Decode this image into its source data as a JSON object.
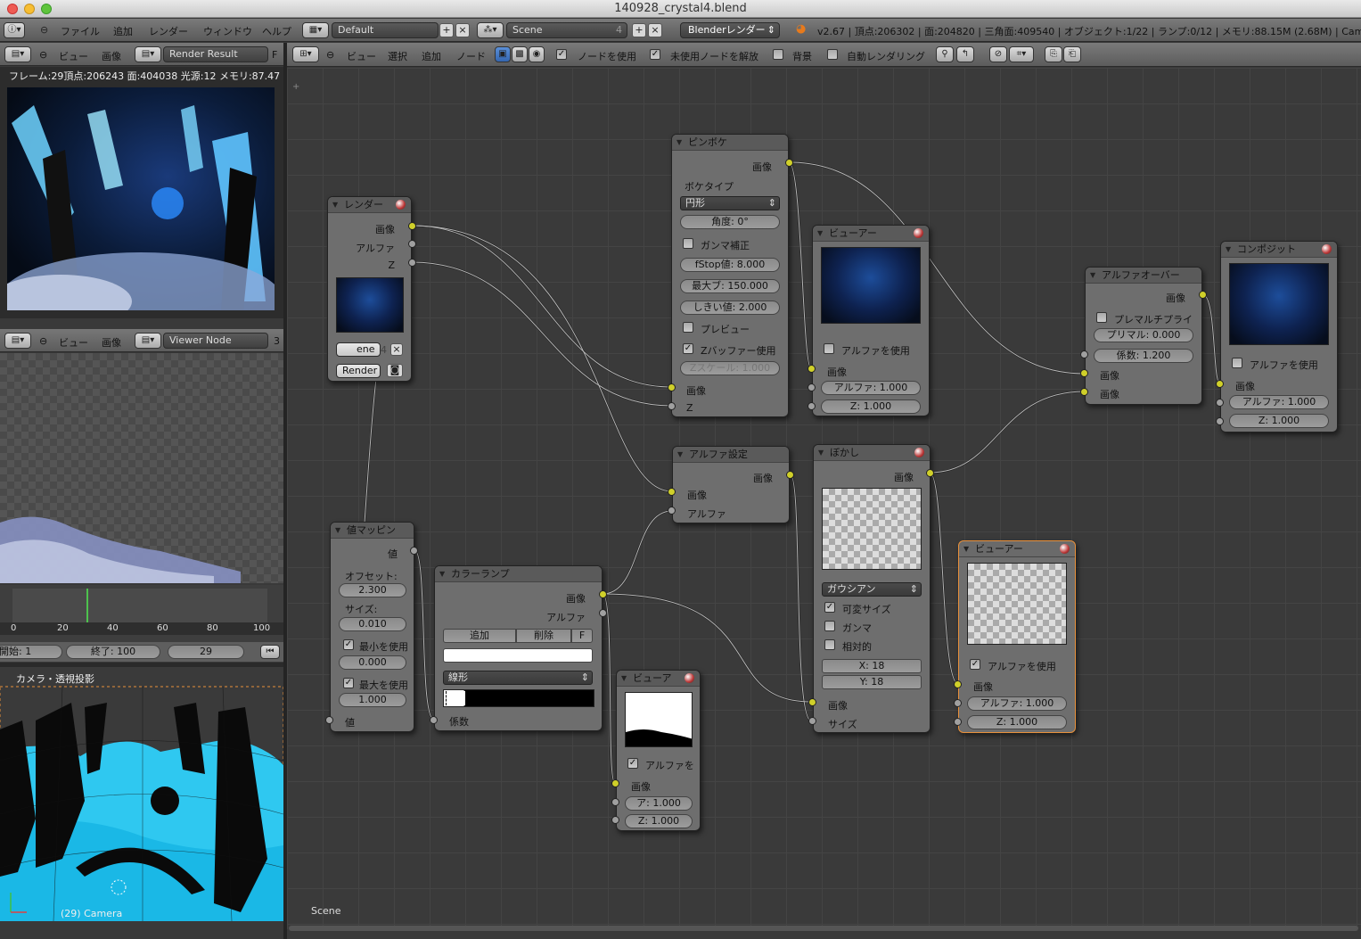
{
  "window": {
    "title": "140928_crystal4.blend"
  },
  "main_header": {
    "menus": [
      "ファイル",
      "追加",
      "レンダー",
      "ウィンドウ",
      "ヘルプ"
    ],
    "layout": "Default",
    "scene": "Scene",
    "scene_users": "4",
    "engine": "Blenderレンダー",
    "stats": "v2.67 | 頂点:206302 | 面:204820 | 三角面:409540 | オブジェクト:1/22 | ランプ:0/12 | メモリ:88.15M (2.68M) | Camera"
  },
  "image_editor_top": {
    "menus": [
      "ビュー",
      "画像"
    ],
    "image_name": "Render Result",
    "slot": "F",
    "info": "フレーム:29頂点:206243 面:404038 光源:12 メモリ:87.47"
  },
  "image_editor_bottom": {
    "menus": [
      "ビュー",
      "画像"
    ],
    "image_name": "Viewer Node",
    "slot": "3"
  },
  "timeline": {
    "ticks": [
      "0",
      "20",
      "40",
      "60",
      "80",
      "100"
    ],
    "start_label": "開始: 1",
    "end_label": "終了: 100",
    "current_frame": "29",
    "current_fraction": 0.29
  },
  "viewport": {
    "label": "カメラ・透視投影",
    "footer": "(29) Camera"
  },
  "node_header": {
    "menus": [
      "ビュー",
      "選択",
      "追加",
      "ノード"
    ],
    "use_nodes": "ノードを使用",
    "free_unused": "未使用ノードを解放",
    "backdrop": "背景",
    "auto_render": "自動レンダリング"
  },
  "canvas_label": "Scene",
  "nodes": {
    "render": {
      "title": "レンダー",
      "out_image": "画像",
      "out_alpha": "アルファ",
      "out_z": "Z",
      "scene_field": "ene",
      "scene_num": "4",
      "layer": "Render"
    },
    "defocus": {
      "title": "ピンボケ",
      "out_image": "画像",
      "bokeh_type_label": "ボケタイプ",
      "bokeh_type": "円形",
      "angle": "角度: 0°",
      "gamma": "ガンマ補正",
      "fstop": "fStop値: 8.000",
      "maxblur": "最大ブ: 150.000",
      "threshold": "しきい値: 2.000",
      "preview": "プレビュー",
      "zbuffer": "Zバッファー使用",
      "zscale": "Zスケール: 1.000",
      "in_image": "画像",
      "in_z": "Z"
    },
    "viewer1": {
      "title": "ビューアー",
      "use_alpha": "アルファを使用",
      "in_image": "画像",
      "alpha": "アルファ: 1.000",
      "z": "Z: 1.000"
    },
    "alphaover": {
      "title": "アルファオーバー",
      "out_image": "画像",
      "premul_conv": "プレマルチプライ",
      "premul": "プリマル: 0.000",
      "factor": "係数: 1.200",
      "in_image1": "画像",
      "in_image2": "画像"
    },
    "composite": {
      "title": "コンポジット",
      "use_alpha": "アルファを使用",
      "in_image": "画像",
      "alpha": "アルファ: 1.000",
      "z": "Z: 1.000"
    },
    "setalpha": {
      "title": "アルファ設定",
      "out_image": "画像",
      "in_image": "画像",
      "in_alpha": "アルファ"
    },
    "blur": {
      "title": "ぼかし",
      "out_image": "画像",
      "filter": "ガウシアン",
      "variable": "可変サイズ",
      "gamma": "ガンマ",
      "relative": "相対的",
      "x": "X: 18",
      "y": "Y: 18",
      "in_image": "画像",
      "in_size": "サイズ"
    },
    "viewer2": {
      "title": "ビューアー",
      "use_alpha": "アルファを使用",
      "in_image": "画像",
      "alpha": "アルファ: 1.000",
      "z": "Z: 1.000"
    },
    "mapvalue": {
      "title": "値マッピン",
      "out_value": "値",
      "offset_label": "オフセット:",
      "offset": "2.300",
      "size_label": "サイズ:",
      "size": "0.010",
      "use_min": "最小を使用",
      "min": "0.000",
      "use_max": "最大を使用",
      "max": "1.000",
      "in_value": "値"
    },
    "colorramp": {
      "title": "カラーランプ",
      "out_image": "画像",
      "out_alpha": "アルファ",
      "add": "追加",
      "delete": "削除",
      "flip": "F",
      "interp": "線形",
      "in_fac": "係数"
    },
    "viewer3": {
      "title": "ビューア",
      "use_alpha": "アルファを",
      "in_image": "画像",
      "alpha": "ア: 1.000",
      "z": "Z: 1.000"
    }
  },
  "colors": {
    "accent": "#e8903a",
    "socket_color": "#d0d02a",
    "socket_value": "#a0a0a0"
  }
}
